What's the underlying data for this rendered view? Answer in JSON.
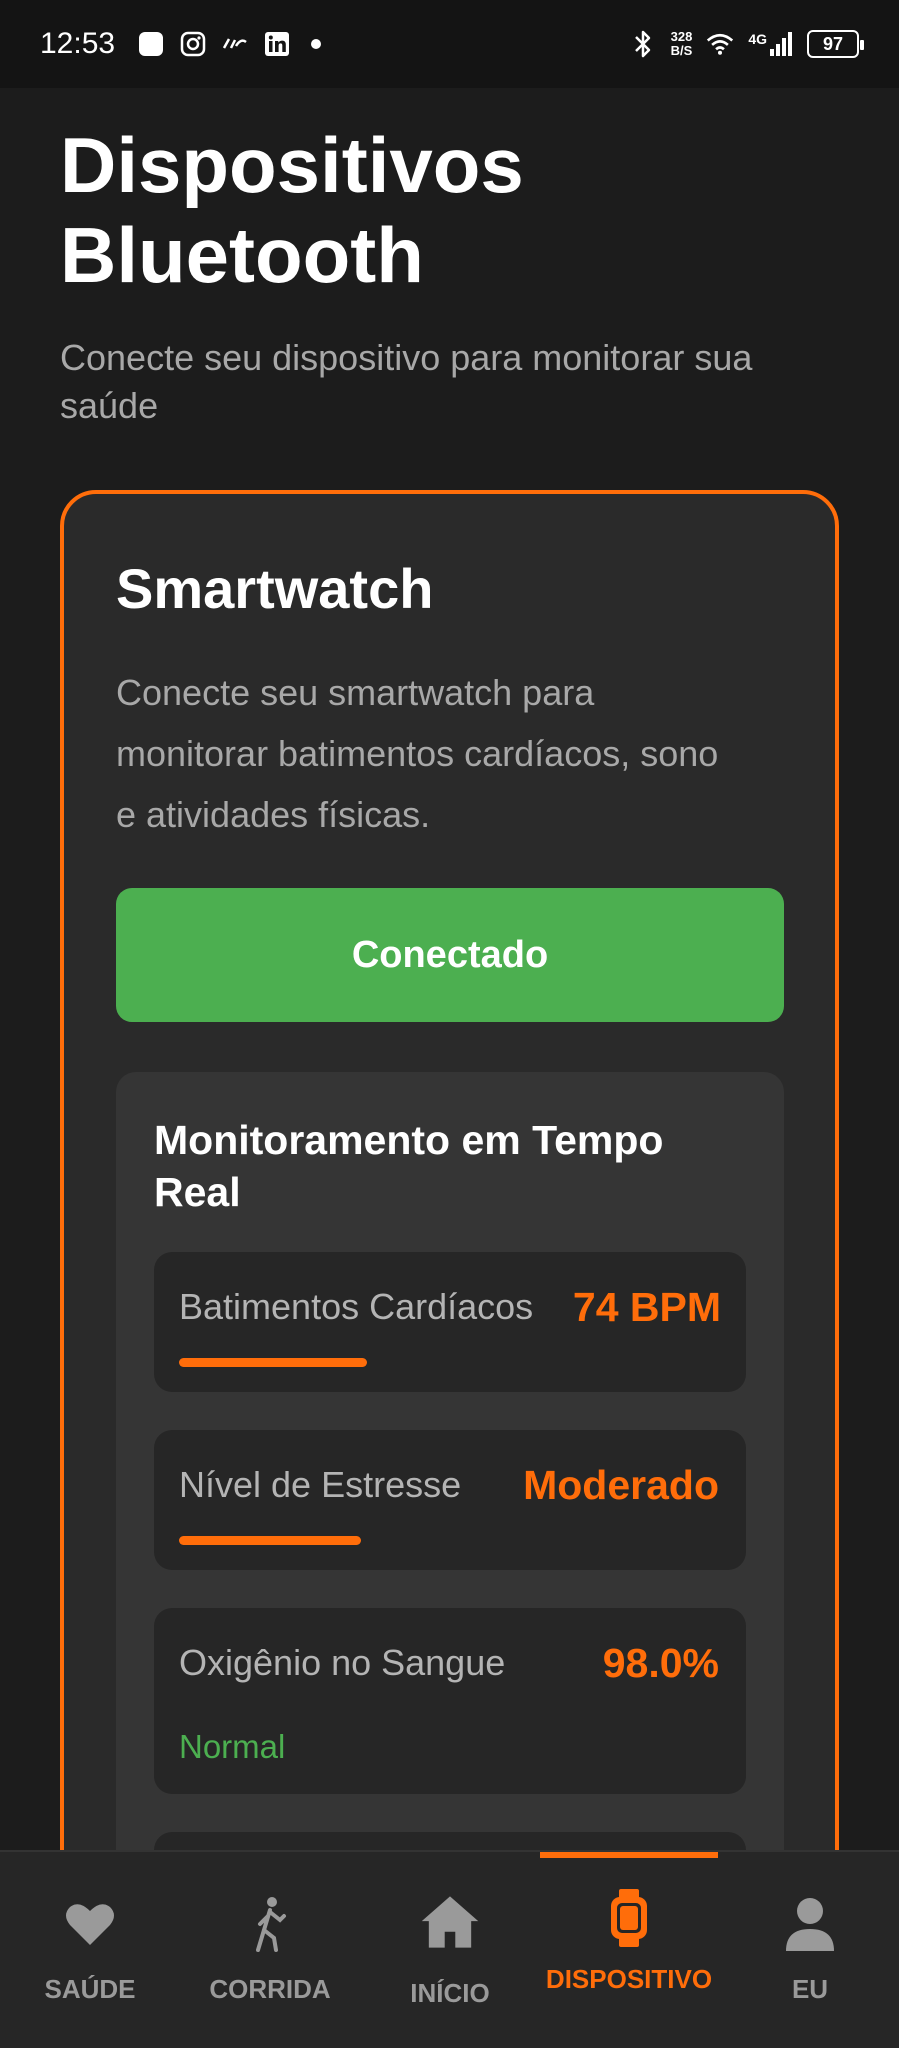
{
  "status_bar": {
    "time": "12:53",
    "net_speed_value": "328",
    "net_speed_unit": "B/S",
    "network": "4G",
    "battery": "97"
  },
  "header": {
    "title": "Dispositivos Bluetooth",
    "subtitle": "Conecte seu dispositivo para monitorar sua saúde"
  },
  "card": {
    "title": "Smartwatch",
    "description": "Conecte seu smartwatch para monitorar batimentos cardíacos, sono e atividades físicas.",
    "button_label": "Conectado",
    "monitor": {
      "title": "Monitoramento em Tempo Real",
      "metrics": [
        {
          "label": "Batimentos Cardíacos",
          "value": "74 BPM"
        },
        {
          "label": "Nível de Estresse",
          "value": "Moderado"
        },
        {
          "label": "Oxigênio no Sangue",
          "value": "98.0%",
          "status": "Normal"
        }
      ]
    }
  },
  "bottom_nav": {
    "items": [
      {
        "label": "SAÚDE",
        "icon": "heart-icon"
      },
      {
        "label": "CORRIDA",
        "icon": "walking-icon"
      },
      {
        "label": "INÍCIO",
        "icon": "home-icon"
      },
      {
        "label": "DISPOSITIVO",
        "icon": "watch-icon",
        "active": true
      },
      {
        "label": "EU",
        "icon": "person-icon"
      }
    ]
  },
  "colors": {
    "accent": "#ff6d0a",
    "success": "#4caf50",
    "background": "#1c1c1c"
  }
}
